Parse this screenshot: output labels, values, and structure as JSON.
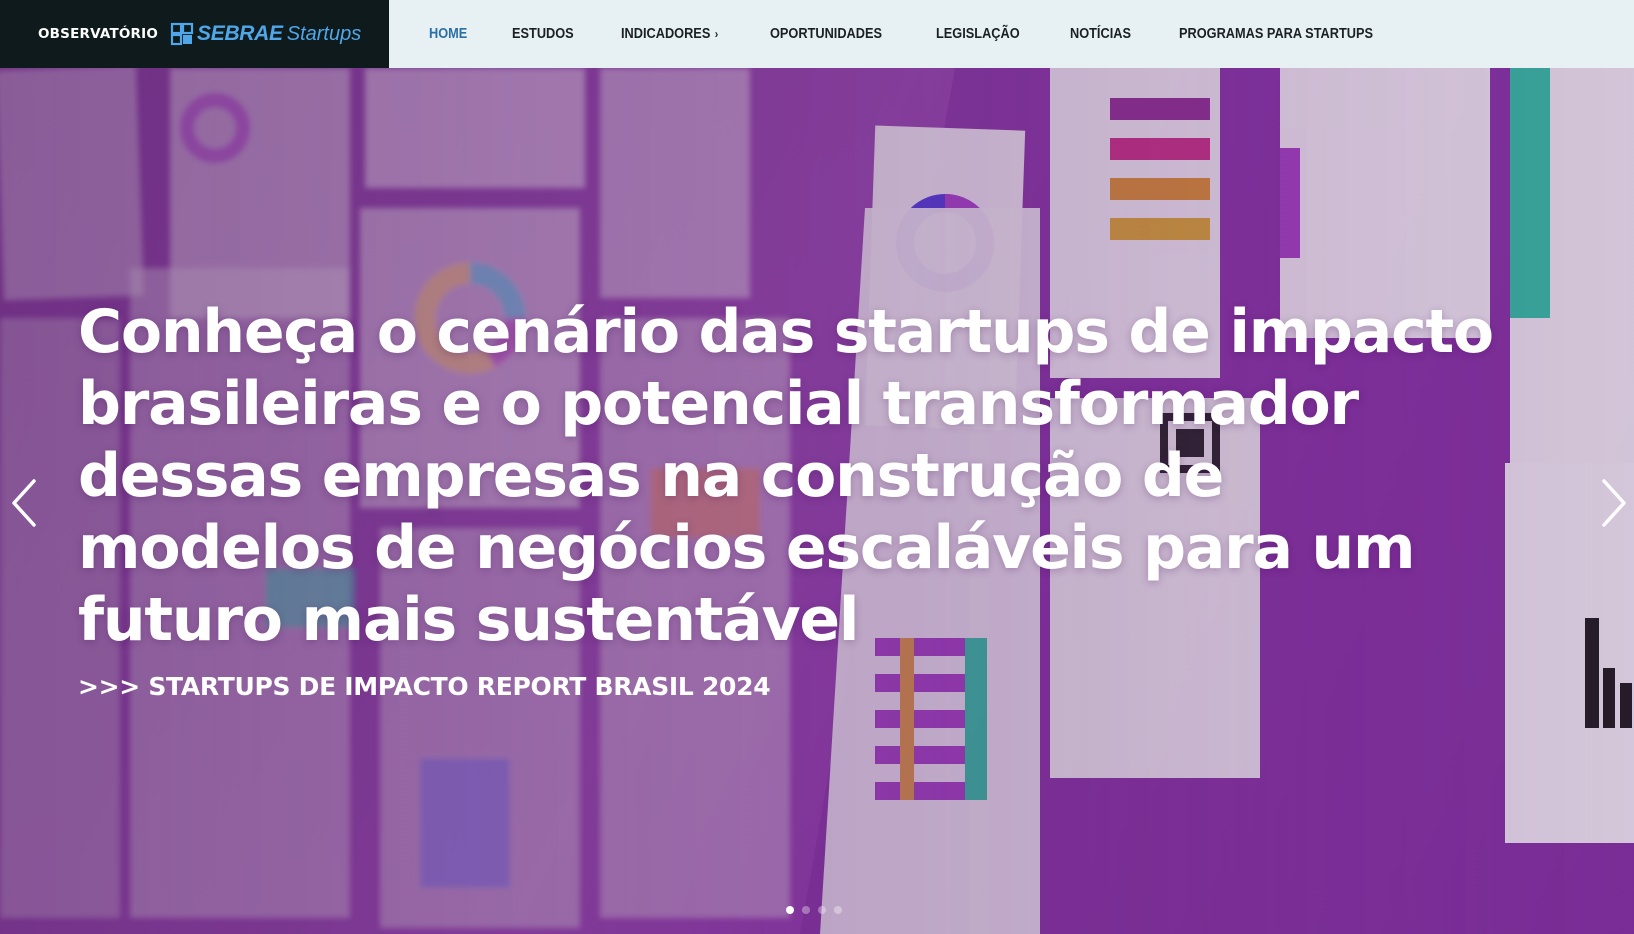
{
  "header": {
    "brand_prefix": "OBSERVATÓRIO",
    "brand_name": "SEBRAE",
    "brand_suffix": "Startups",
    "nav": [
      {
        "label": "HOME",
        "active": true
      },
      {
        "label": "ESTUDOS"
      },
      {
        "label": "INDICADORES",
        "has_submenu": true
      },
      {
        "label": "OPORTUNIDADES"
      },
      {
        "label": "LEGISLAÇÃO"
      },
      {
        "label": "NOTÍCIAS"
      },
      {
        "label": "PROGRAMAS PARA STARTUPS"
      }
    ]
  },
  "hero": {
    "headline": "Conheça o cenário das startups de impacto brasileiras e o potencial transformador dessas empresas na construção de modelos de negócios escaláveis para um futuro mais sustentável",
    "subline": ">>> STARTUPS DE IMPACTO REPORT BRASIL 2024",
    "slides_count": 4,
    "active_slide": 1
  },
  "icons": {
    "prev": "chevron-left-icon",
    "next": "chevron-right-icon",
    "caret": "chevron-right-icon",
    "brand": "sebrae-logo-mark"
  },
  "colors": {
    "brand_bg": "#0e1a1c",
    "nav_bg": "#e7f0f3",
    "nav_active": "#2a6fa6",
    "brand_blue": "#4fa6e8",
    "hero_purple": "#8b3aa6"
  }
}
